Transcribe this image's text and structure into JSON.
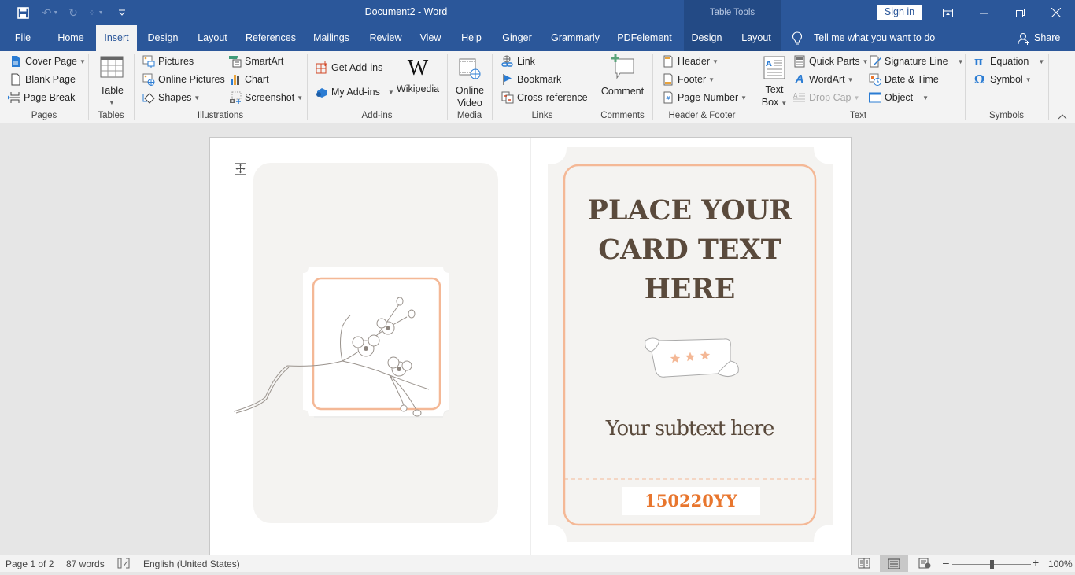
{
  "window": {
    "title": "Document2  -  Word",
    "contextual_group": "Table Tools",
    "sign_in_label": "Sign in",
    "controls": [
      "ribbon-display-options",
      "minimize",
      "restore",
      "close"
    ]
  },
  "quick_access": [
    {
      "name": "save",
      "icon": "save-icon",
      "enabled": true
    },
    {
      "name": "undo",
      "icon": "undo-icon",
      "enabled": false
    },
    {
      "name": "redo",
      "icon": "redo-icon",
      "enabled": false
    },
    {
      "name": "touch-mode",
      "icon": "touch-mode-icon",
      "enabled": false
    },
    {
      "name": "customize",
      "icon": "customize-qat-icon",
      "enabled": true
    }
  ],
  "tabs": [
    {
      "label": "File"
    },
    {
      "label": "Home"
    },
    {
      "label": "Insert",
      "active": true
    },
    {
      "label": "Design"
    },
    {
      "label": "Layout"
    },
    {
      "label": "References"
    },
    {
      "label": "Mailings"
    },
    {
      "label": "Review"
    },
    {
      "label": "View"
    },
    {
      "label": "Help"
    },
    {
      "label": "Ginger"
    },
    {
      "label": "Grammarly"
    },
    {
      "label": "PDFelement"
    },
    {
      "label": "Design",
      "contextual": true
    },
    {
      "label": "Layout",
      "contextual": true
    }
  ],
  "tell_me": "Tell me what you want to do",
  "share_label": "Share",
  "ribbon": {
    "groups": {
      "pages": {
        "label": "Pages",
        "items": [
          "Cover Page",
          "Blank Page",
          "Page Break"
        ]
      },
      "tables": {
        "label": "Tables",
        "items": [
          "Table"
        ]
      },
      "illustrations": {
        "label": "Illustrations",
        "items": [
          "Pictures",
          "Online Pictures",
          "Shapes",
          "SmartArt",
          "Chart",
          "Screenshot"
        ]
      },
      "addins": {
        "label": "Add-ins",
        "items": [
          "Get Add-ins",
          "My Add-ins",
          "Wikipedia"
        ]
      },
      "media": {
        "label": "Media",
        "items": [
          "Online",
          "Video"
        ]
      },
      "links": {
        "label": "Links",
        "items": [
          "Link",
          "Bookmark",
          "Cross-reference"
        ]
      },
      "comments": {
        "label": "Comments",
        "items": [
          "Comment"
        ]
      },
      "header_footer": {
        "label": "Header & Footer",
        "items": [
          "Header",
          "Footer",
          "Page Number"
        ]
      },
      "text": {
        "label": "Text",
        "items": [
          "Text",
          "Box",
          "Quick Parts",
          "WordArt",
          "Drop Cap",
          "Signature Line",
          "Date & Time",
          "Object"
        ]
      },
      "symbols": {
        "label": "Symbols",
        "items": [
          "Equation",
          "Symbol"
        ]
      }
    }
  },
  "document": {
    "card": {
      "heading_lines": [
        "PLACE YOUR",
        "CARD TEXT",
        "HERE"
      ],
      "subtext": "Your subtext here",
      "code": "150220YY",
      "stars": 3
    },
    "colors": {
      "accent_peach": "#f4b896",
      "heading_brown": "#5a4a3c",
      "code_orange": "#e8762e",
      "card_bg": "#f4f3f1"
    }
  },
  "status": {
    "page": "Page 1 of 2",
    "words": "87 words",
    "language": "English (United States)",
    "zoom": "100%",
    "zoom_percent": 100
  }
}
